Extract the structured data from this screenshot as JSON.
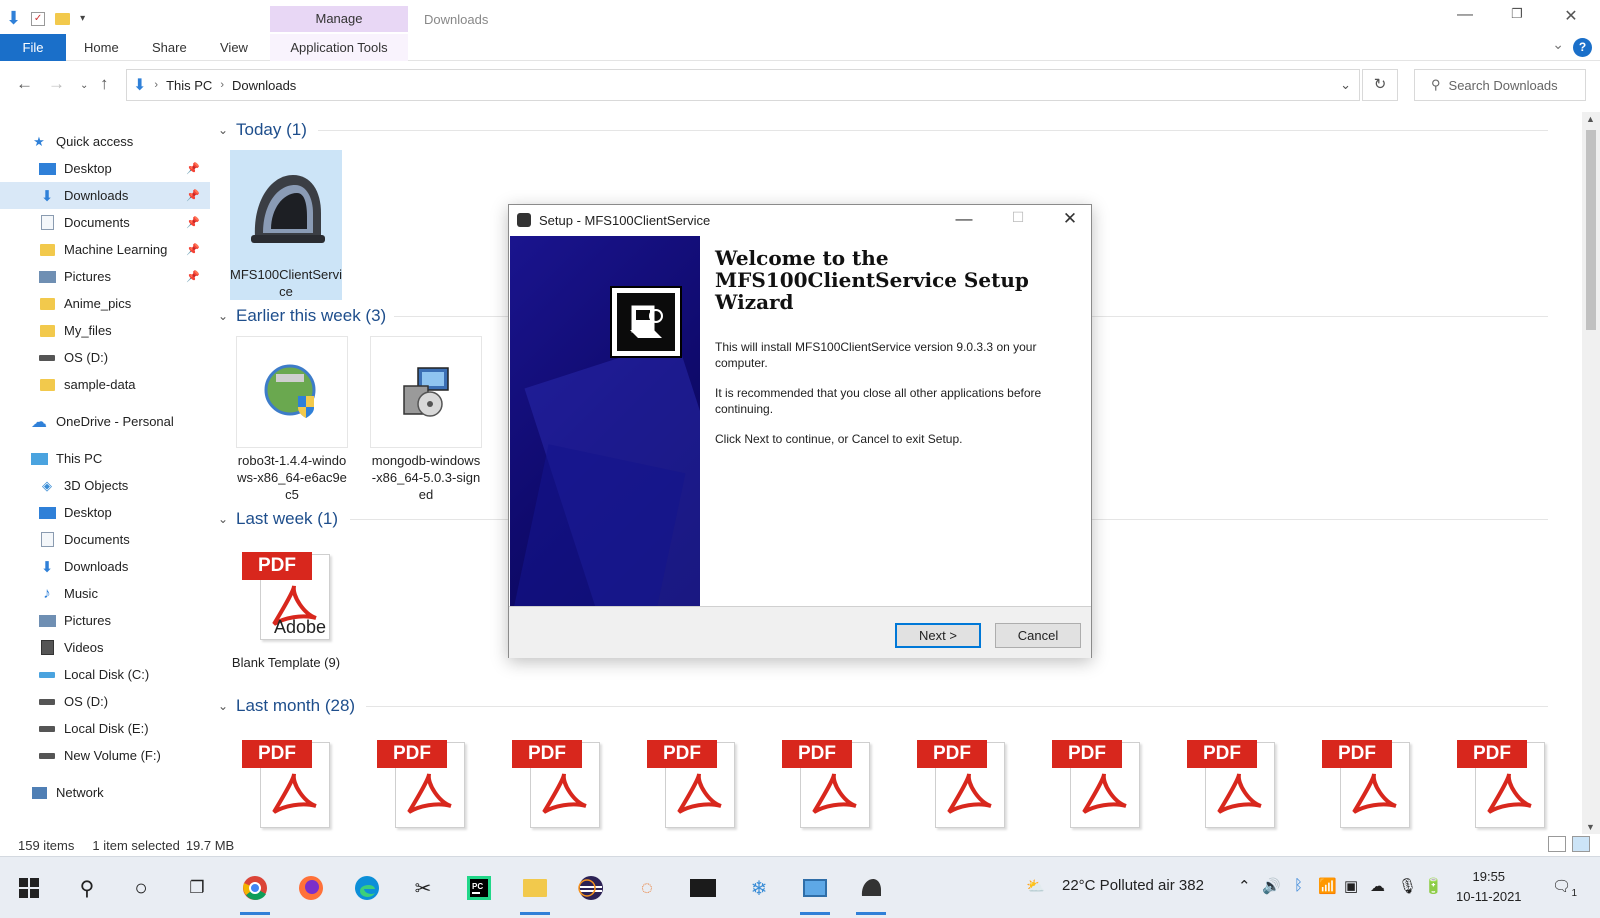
{
  "window": {
    "title": "Downloads",
    "context_tab": "Manage",
    "ribbon_tabs": [
      "File",
      "Home",
      "Share",
      "View",
      "Application Tools"
    ]
  },
  "address": {
    "crumbs": [
      "This PC",
      "Downloads"
    ],
    "search_placeholder": "Search Downloads"
  },
  "nav": {
    "quick_access": "Quick access",
    "quick_items": [
      "Desktop",
      "Downloads",
      "Documents",
      "Machine Learning",
      "Pictures",
      "Anime_pics",
      "My_files",
      "OS (D:)",
      "sample-data"
    ],
    "onedrive": "OneDrive - Personal",
    "this_pc": "This PC",
    "pc_items": [
      "3D Objects",
      "Desktop",
      "Documents",
      "Downloads",
      "Music",
      "Pictures",
      "Videos",
      "Local Disk (C:)",
      "OS (D:)",
      "Local Disk (E:)",
      "New Volume (F:)"
    ],
    "network": "Network"
  },
  "groups": {
    "today": "Today (1)",
    "earlier_week": "Earlier this week (3)",
    "last_week": "Last week (1)",
    "last_month": "Last month (28)"
  },
  "files": {
    "today_1": "MFS100ClientService",
    "week_1": "robo3t-1.4.4-windows-x86_64-e6ac9ec5",
    "week_2": "mongodb-windows-x86_64-5.0.3-signed",
    "lastweek_1": "Blank Template (9)",
    "pdf_label": "PDF",
    "adobe_label": "Adobe"
  },
  "status": {
    "count": "159 items",
    "selected": "1 item selected",
    "size": "19.7 MB"
  },
  "dialog": {
    "title": "Setup - MFS100ClientService",
    "heading": "Welcome to the MFS100ClientService Setup Wizard",
    "p1": "This will install MFS100ClientService version 9.0.3.3 on your computer.",
    "p2": "It is recommended that you close all other applications before continuing.",
    "p3": "Click Next to continue, or Cancel to exit Setup.",
    "next": "Next >",
    "cancel": "Cancel"
  },
  "taskbar": {
    "weather": "22°C  Polluted air 382",
    "time": "19:55",
    "date": "10-11-2021",
    "notifications": "1"
  },
  "colors": {
    "accent": "#1a6fc9",
    "manage_tab": "#e8d7f5",
    "selection": "#cce4f7",
    "dialog_side": "#1a148e",
    "pdf_red": "#d8271d"
  }
}
